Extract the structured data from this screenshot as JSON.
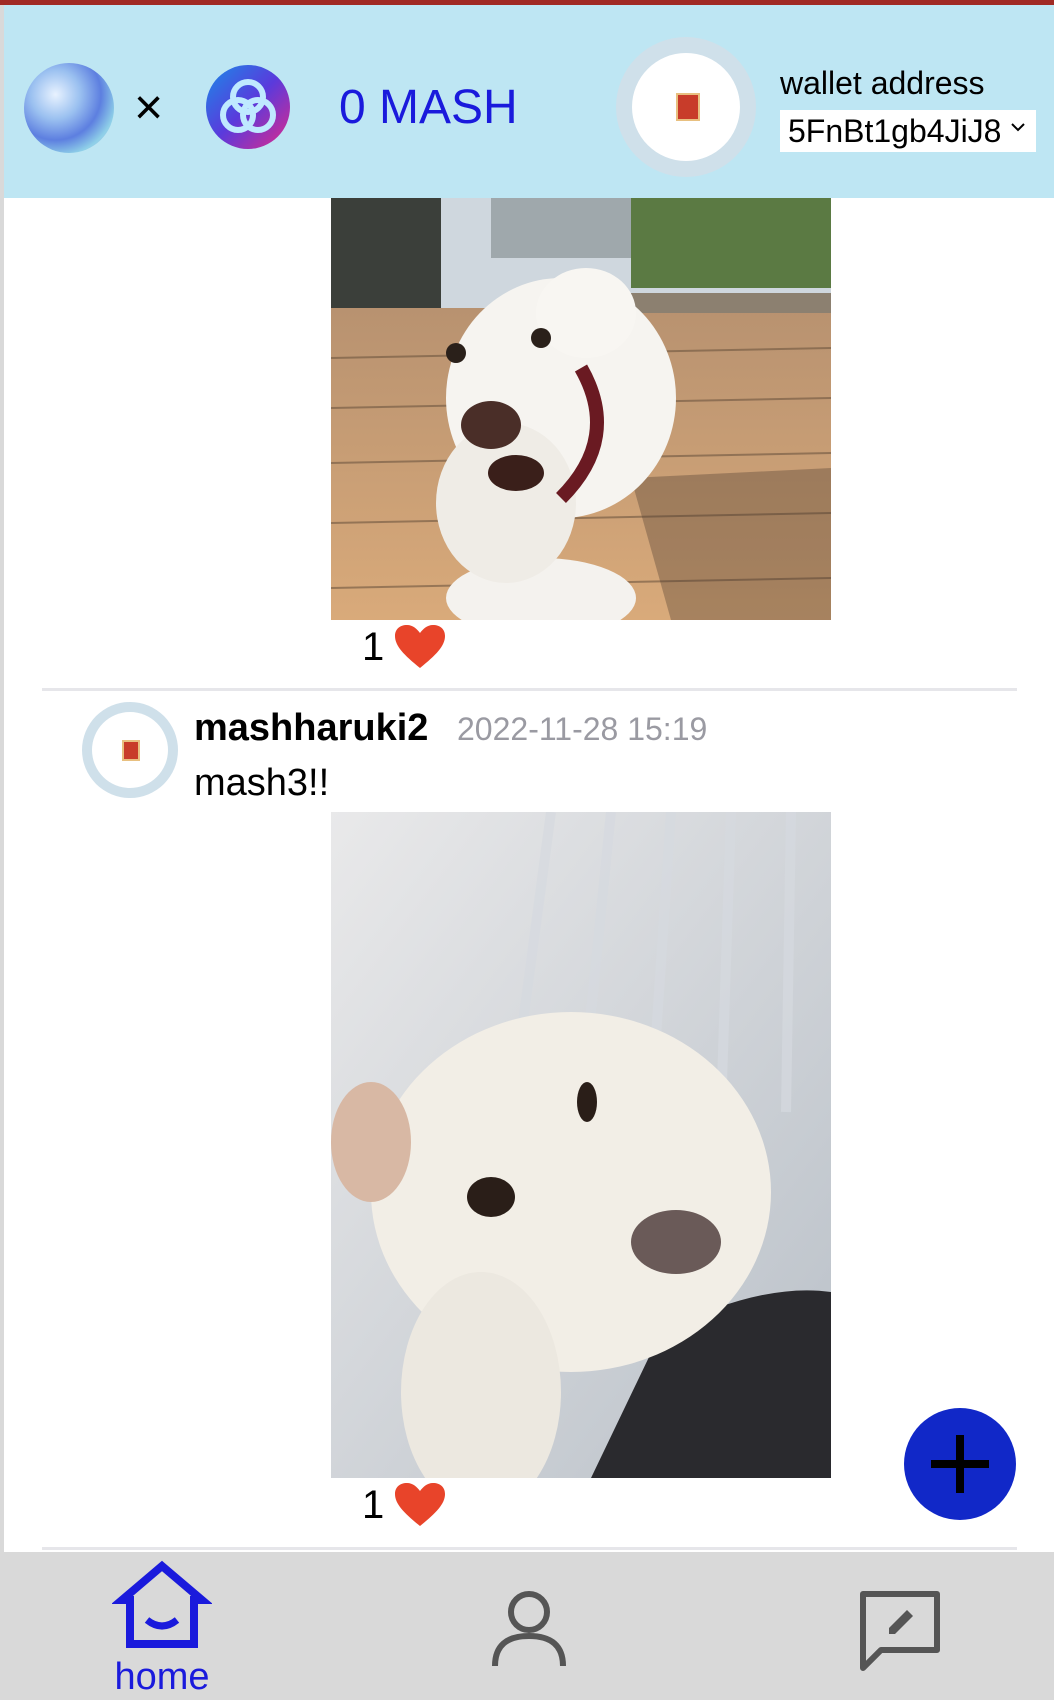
{
  "header": {
    "cross_symbol": "×",
    "balance": "0 MASH",
    "wallet_label": "wallet address",
    "wallet_value": "5FnBt1gb4JiJ8"
  },
  "posts": [
    {
      "likes": "1"
    },
    {
      "username": "mashharuki2",
      "timestamp": "2022-11-28 15:19",
      "text": "mash3!!",
      "likes": "1"
    }
  ],
  "nav": {
    "home_label": "home"
  },
  "colors": {
    "header_bg": "#bee6f3",
    "accent_blue": "#1a1adc",
    "fab_blue": "#1128c8",
    "heart_red": "#e8442a",
    "nav_bg": "#d9d9d9"
  },
  "icons": [
    "logo-icon",
    "astar-logo-icon",
    "heart-icon",
    "chevron-down-icon",
    "plus-icon",
    "home-icon",
    "profile-icon",
    "edit-message-icon"
  ]
}
